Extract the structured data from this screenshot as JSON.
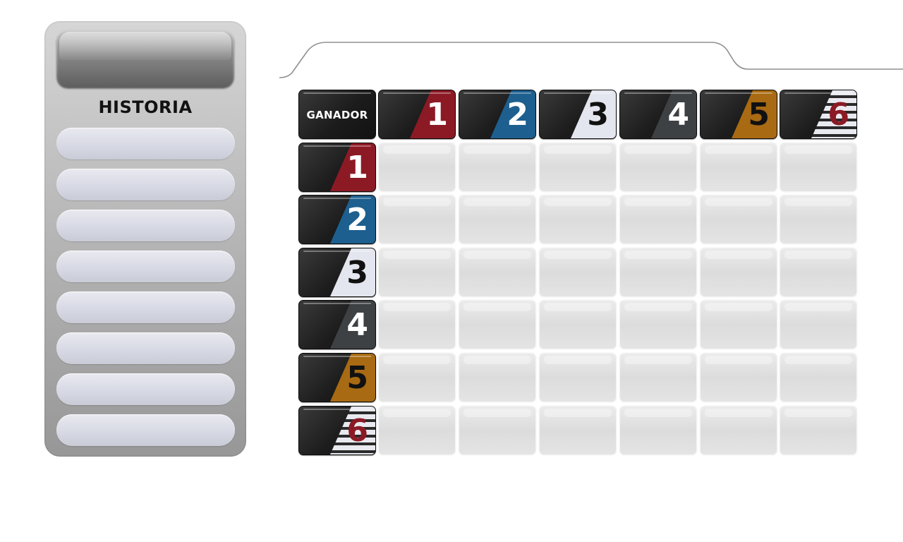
{
  "history": {
    "title": "HISTORIA",
    "slots": [
      "",
      "",
      "",
      "",
      "",
      "",
      "",
      ""
    ]
  },
  "grid": {
    "corner_label": "GANADOR",
    "horses": [
      {
        "number": "1",
        "color": "#8c1a25",
        "number_color": "#ffffff",
        "pattern": "solid"
      },
      {
        "number": "2",
        "color": "#1d5f8e",
        "number_color": "#ffffff",
        "pattern": "solid"
      },
      {
        "number": "3",
        "color": "#e4e6ef",
        "number_color": "#111111",
        "pattern": "solid"
      },
      {
        "number": "4",
        "color": "#3e4144",
        "number_color": "#ffffff",
        "pattern": "solid"
      },
      {
        "number": "5",
        "color": "#a86a12",
        "number_color": "#111111",
        "pattern": "solid"
      },
      {
        "number": "6",
        "color": "#e9eaf0",
        "number_color": "#8c1a25",
        "pattern": "zebra-stripes"
      }
    ],
    "board": [
      [
        "",
        "",
        "",
        "",
        "",
        ""
      ],
      [
        "",
        "",
        "",
        "",
        "",
        ""
      ],
      [
        "",
        "",
        "",
        "",
        "",
        ""
      ],
      [
        "",
        "",
        "",
        "",
        "",
        ""
      ],
      [
        "",
        "",
        "",
        "",
        "",
        ""
      ],
      [
        "",
        "",
        "",
        "",
        "",
        ""
      ]
    ]
  }
}
